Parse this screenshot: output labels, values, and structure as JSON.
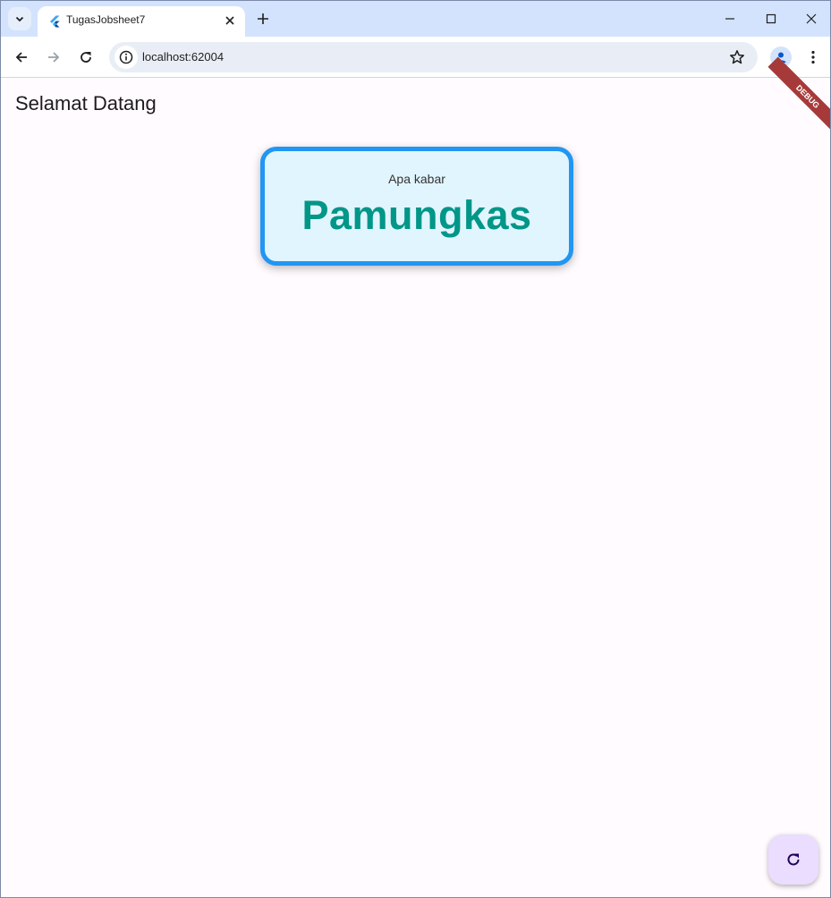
{
  "browser": {
    "tab": {
      "title": "TugasJobsheet7"
    },
    "address": {
      "url": "localhost:62004"
    }
  },
  "app": {
    "title": "Selamat Datang",
    "card": {
      "subtitle": "Apa kabar",
      "name": "Pamungkas"
    },
    "debug_banner": "DEBUG",
    "fab_icon": "refresh-icon"
  },
  "colors": {
    "card_background": "#e1f5fe",
    "card_border": "#2196f3",
    "name_text": "#009688",
    "fab_background": "#eaddff",
    "debug_banner": "#a63a3a"
  }
}
